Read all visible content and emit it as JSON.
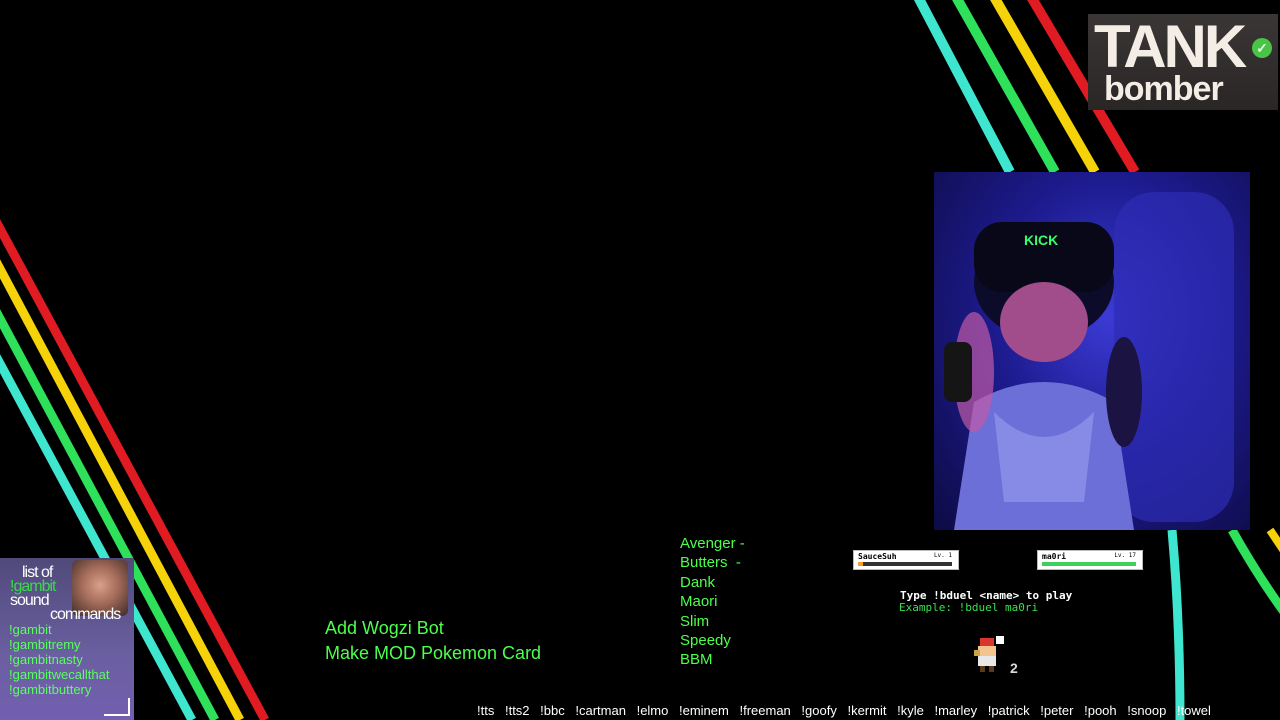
{
  "logo": {
    "main": "TANK",
    "sub": "bomber",
    "badge": "verified-check-icon"
  },
  "webcam": {
    "cap_text": "KICK"
  },
  "gambit_panel": {
    "title_line1": "list of",
    "title_line2": "!gambit",
    "title_line3": "sound",
    "title_line4": "commands",
    "commands": [
      "!gambit",
      "!gambitremy",
      "!gambitnasty",
      "!gambitwecallthat",
      "!gambitbuttery"
    ]
  },
  "todo": {
    "line1": "Add Wogzi Bot",
    "line2": "Make MOD Pokemon Card"
  },
  "names_list": [
    "Avenger -",
    "Butters  -",
    "Dank",
    "Maori",
    "Slim",
    "Speedy",
    "BBM"
  ],
  "duel": {
    "player1": {
      "name": "SauceSuh",
      "level": "Lv. 1",
      "hp": 0.05
    },
    "player2": {
      "name": "ma0ri",
      "level": "Lv. 17",
      "hp": 1.0
    },
    "instruction": "Type !bduel <name> to play",
    "example": "Example: !bduel ma0ri",
    "sprite_count": "2"
  },
  "sound_commands": [
    "!tts",
    "!tts2",
    "!bbc",
    "!cartman",
    "!elmo",
    "!eminem",
    "!freeman",
    "!goofy",
    "!kermit",
    "!kyle",
    "!marley",
    "!patrick",
    "!peter",
    "!pooh",
    "!snoop",
    "!towel"
  ],
  "colors": {
    "accent_green": "#4dff4d",
    "stripe_red": "#e01b22",
    "stripe_yellow": "#f5d20a",
    "stripe_green": "#2fe05a",
    "stripe_cyan": "#3fe6cf"
  }
}
